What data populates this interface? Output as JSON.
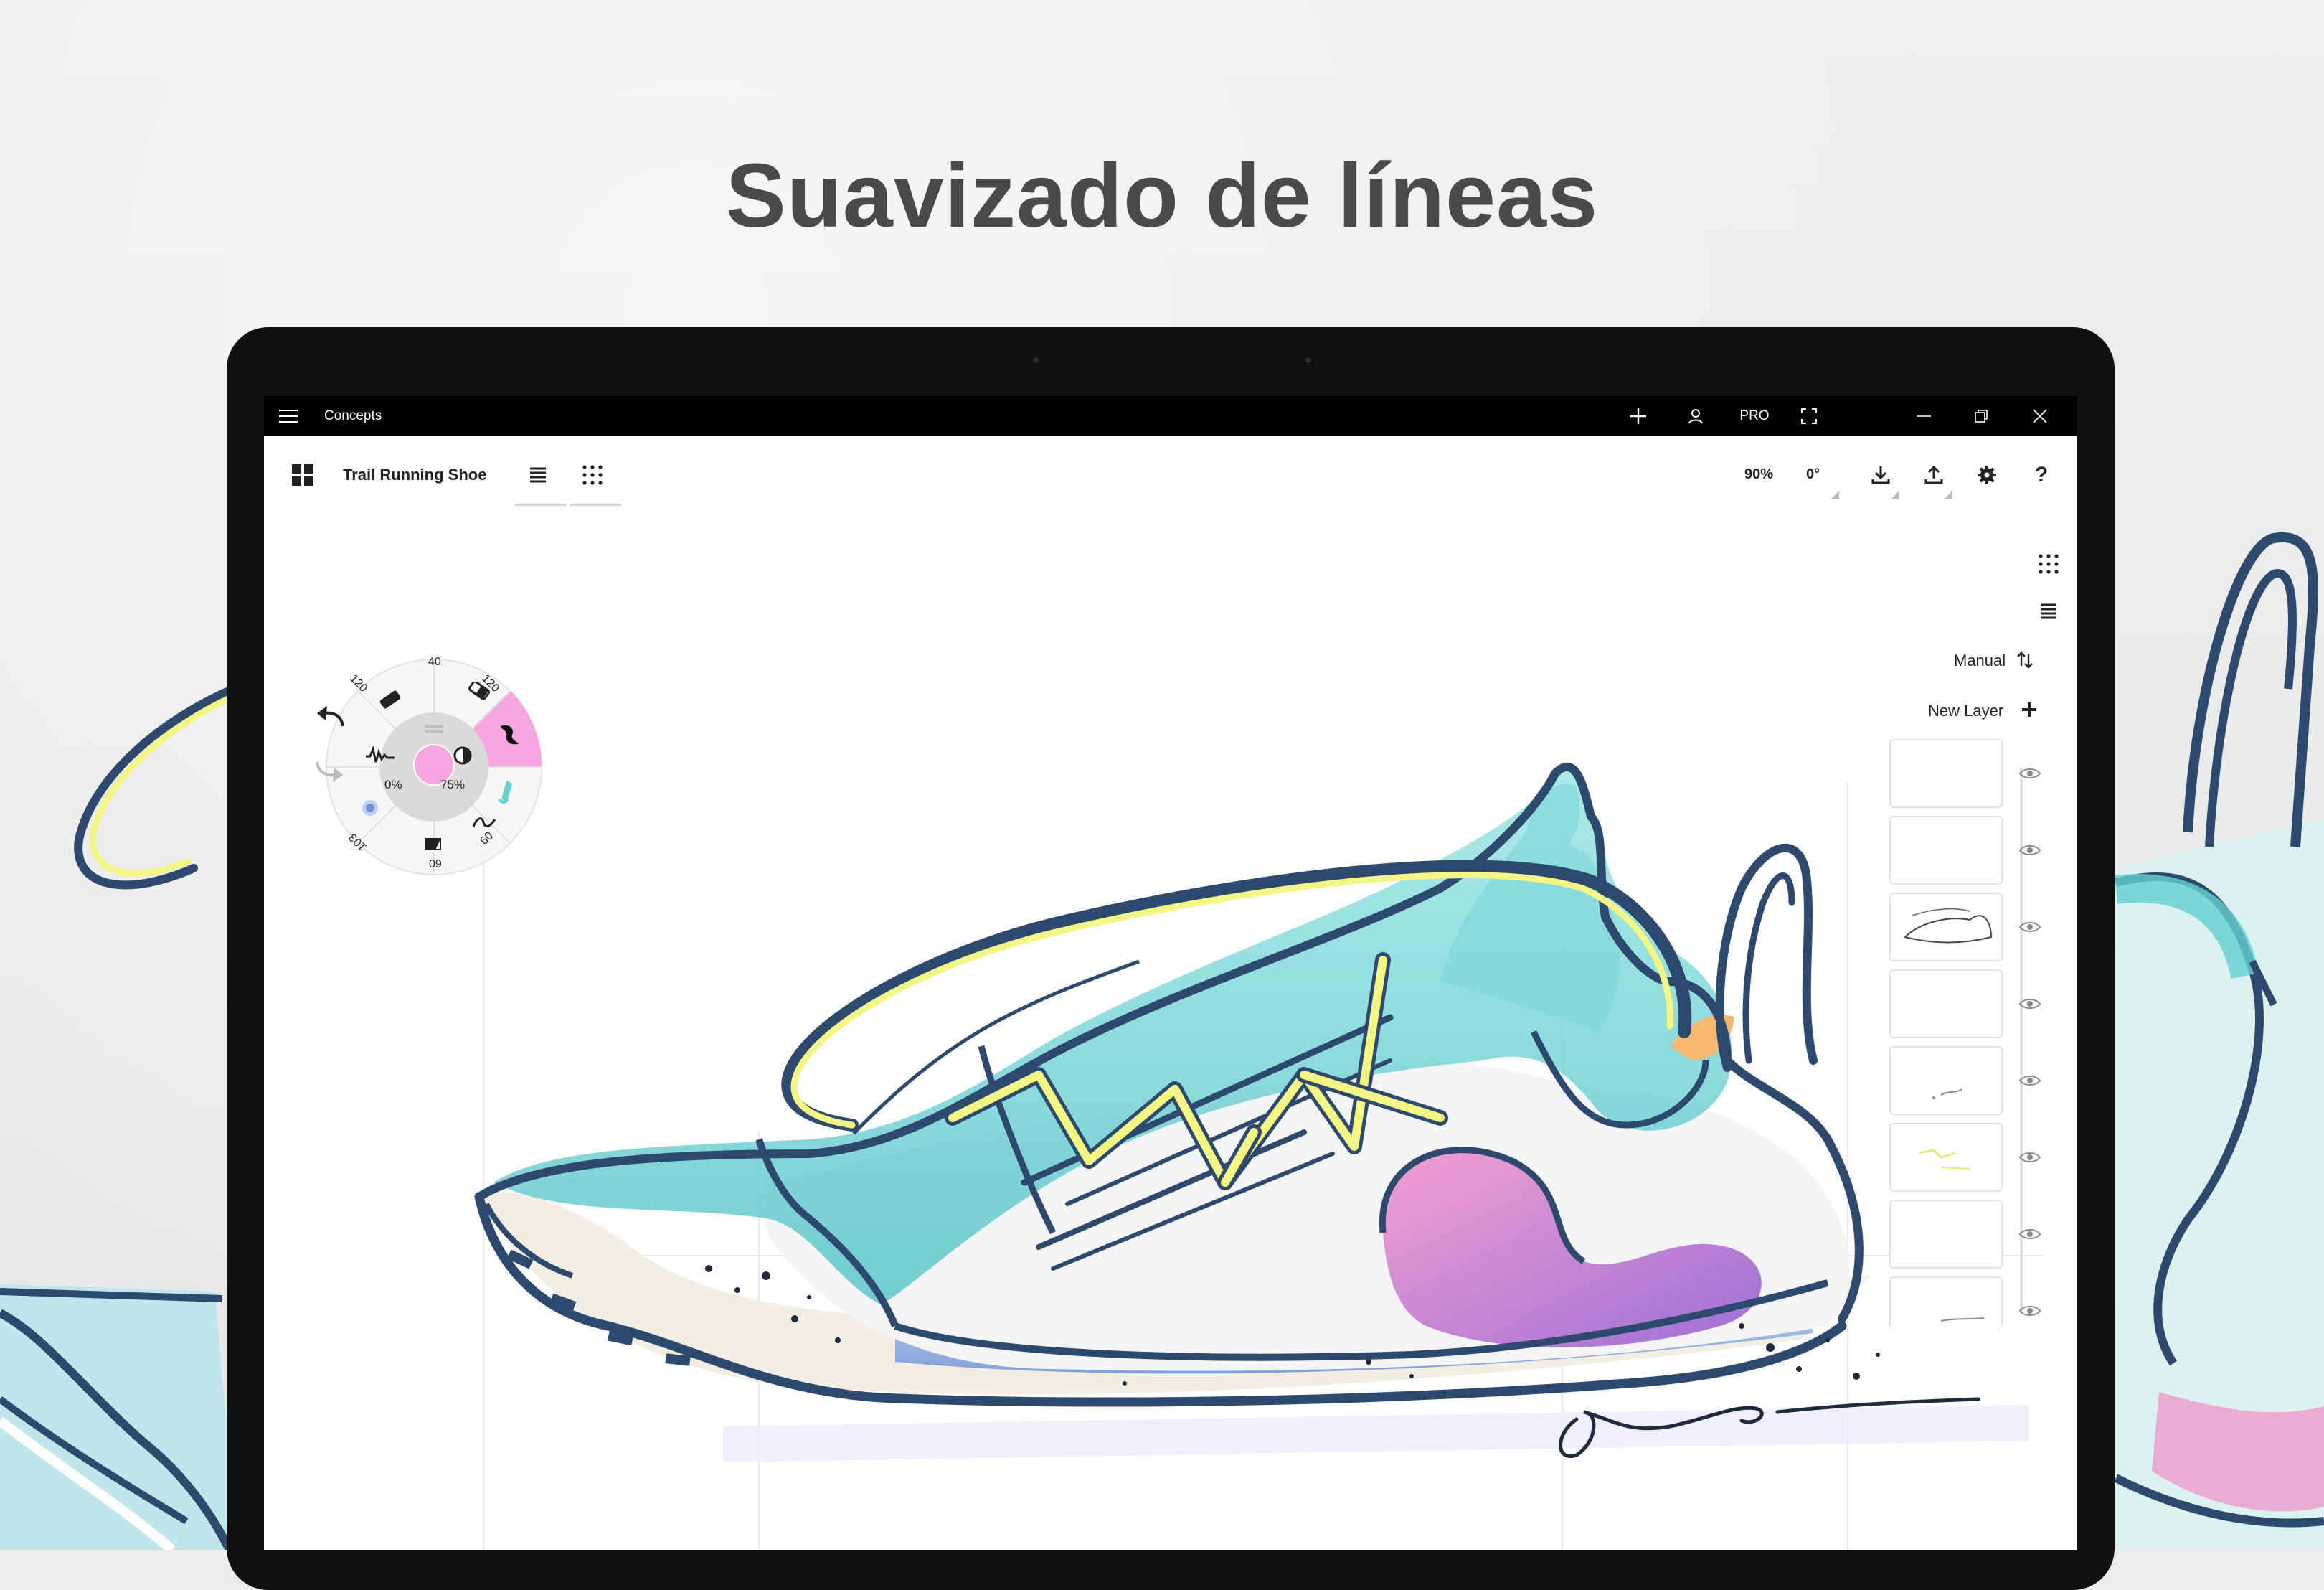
{
  "headline": "Suavizado de líneas",
  "app": {
    "title": "Concepts",
    "menu_icon": "hamburger-icon",
    "add_icon": "plus-icon",
    "account_icon": "user-icon",
    "pro_label": "PRO",
    "fullscreen_icon": "fullscreen-icon",
    "window_controls": [
      "minimize-icon",
      "restore-icon",
      "close-icon"
    ]
  },
  "toolbar": {
    "gallery_icon": "grid-icon",
    "document_title": "Trail Running Shoe",
    "layers_toggle_icon": "layers-icon",
    "grid_toggle_icon": "dot-grid-icon",
    "zoom": "90%",
    "rotation": "0°",
    "import_icon": "download-icon",
    "export_icon": "upload-icon",
    "settings_icon": "gear-icon",
    "help_label": "?"
  },
  "right_panel": {
    "grid_icon": "dot-grid-icon",
    "layers_icon": "layers-icon",
    "sort_label": "Manual",
    "sort_icon": "sort-icon",
    "new_layer_label": "New Layer",
    "new_layer_icon": "plus-icon",
    "layers": [
      {
        "thumb": "empty",
        "visible": true
      },
      {
        "thumb": "empty",
        "visible": true
      },
      {
        "thumb": "shoe-sketch",
        "visible": true
      },
      {
        "thumb": "empty",
        "visible": true
      },
      {
        "thumb": "small-marks",
        "visible": true
      },
      {
        "thumb": "yellow-laces",
        "visible": true
      },
      {
        "thumb": "empty",
        "visible": true
      },
      {
        "thumb": "sole-marks",
        "visible": true
      }
    ]
  },
  "tool_wheel": {
    "undo_icon": "undo-icon",
    "redo_icon": "redo-icon",
    "slots": [
      {
        "label": "40",
        "icon": "pencil-icon"
      },
      {
        "label": "120",
        "icon": "eraser-icon"
      },
      {
        "label": "120",
        "icon": "pen-icon"
      },
      {
        "label": "",
        "icon": "brush-icon",
        "active": true
      },
      {
        "label": "",
        "icon": "marker-icon"
      },
      {
        "label": "09",
        "icon": "wave-icon"
      },
      {
        "label": "09",
        "icon": "fill-icon"
      },
      {
        "label": "103",
        "icon": "airbrush-icon"
      }
    ],
    "smoothing": "0%",
    "opacity": "75%",
    "color": "#f7a6e0"
  },
  "colors": {
    "navy": "#2d4a6e",
    "teal": "#64d1cf",
    "yellow": "#f3f585",
    "pink": "#ef8dc7",
    "purple": "#9c6fd6"
  }
}
